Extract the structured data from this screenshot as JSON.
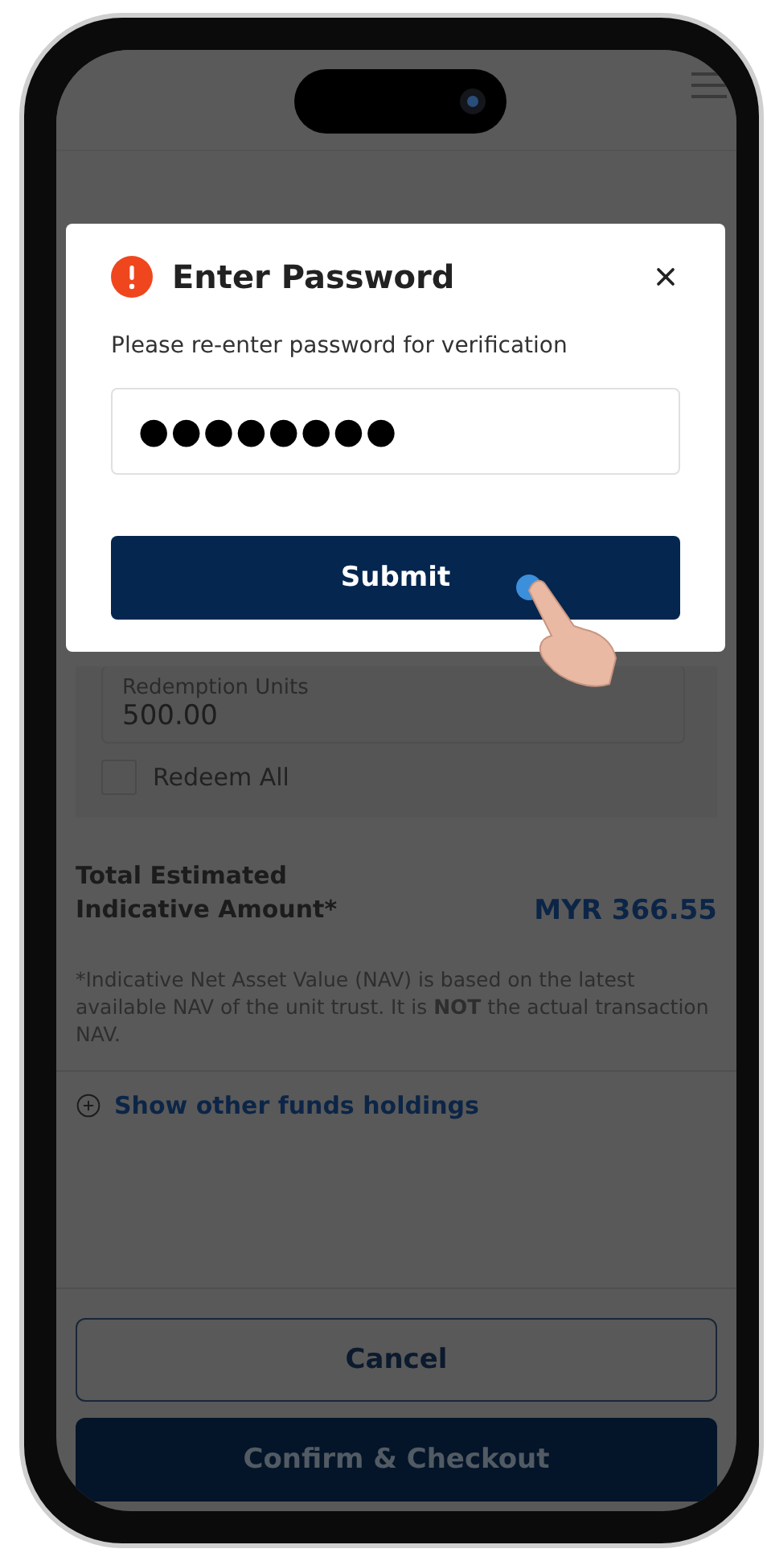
{
  "dialog": {
    "title": "Enter Password",
    "message": "Please re-enter password for verification",
    "password": "●●●●●●●●",
    "submit": "Submit"
  },
  "redemption": {
    "units_label": "Redemption Units",
    "units_value": "500.00",
    "redeem_all": {
      "label": "Redeem All",
      "checked": false
    }
  },
  "total": {
    "label": "Total Estimated Indicative Amount*",
    "amount": "MYR 366.55"
  },
  "note": "*Indicative Net Asset Value (NAV) is based on the latest available NAV of the unit trust. It is **NOT** the actual transaction NAV.",
  "show_other": "Show other funds holdings",
  "buttons": {
    "cancel": "Cancel",
    "confirm": "Confirm & Checkout"
  }
}
